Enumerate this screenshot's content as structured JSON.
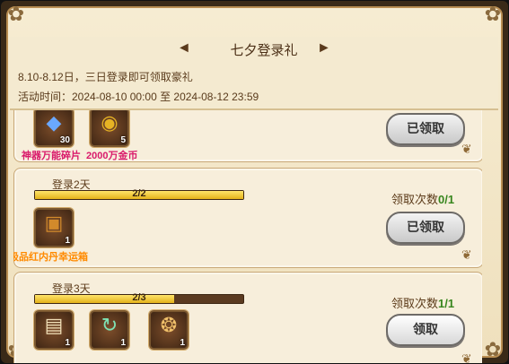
{
  "header": {
    "title": "七夕登录礼",
    "description": "8.10-8.12日，三日登录即可领取豪礼",
    "time_label": "活动时间：2024-08-10 00:00 至 2024-08-12 23:59"
  },
  "cards": [
    {
      "items": [
        {
          "icon_name": "crystal-icon",
          "glyph": "◆",
          "color": "#6aa8ff",
          "qty": "30",
          "label": "神器万能碎片",
          "label_color": "#d91a6b"
        },
        {
          "icon_name": "coin-icon",
          "glyph": "◉",
          "color": "#e6b324",
          "qty": "5",
          "label": "2000万金币",
          "label_color": "#d91a6b"
        }
      ],
      "button_label": "已领取"
    },
    {
      "title": "登录2天",
      "progress_text": "2/2",
      "progress": 1.0,
      "claim_prefix": "领取次数",
      "claim_value": "0/1",
      "items": [
        {
          "icon_name": "treasure-chest-icon",
          "glyph": "▣",
          "color": "#d28a2b",
          "qty": "1",
          "label": "极品红内丹幸运箱",
          "label_color": "#ff8a00"
        }
      ],
      "button_label": "已领取"
    },
    {
      "title": "登录3天",
      "progress_text": "2/3",
      "progress": 0.667,
      "claim_prefix": "领取次数",
      "claim_value": "1/1",
      "items": [
        {
          "icon_name": "scroll-icon",
          "glyph": "▤",
          "color": "#f1e0b8",
          "qty": "1"
        },
        {
          "icon_name": "refresh-scroll-icon",
          "glyph": "↻",
          "color": "#7ee2b4",
          "qty": "1"
        },
        {
          "icon_name": "tome-icon",
          "glyph": "❂",
          "color": "#f0c06a",
          "qty": "1"
        }
      ],
      "button_label": "领取"
    }
  ]
}
